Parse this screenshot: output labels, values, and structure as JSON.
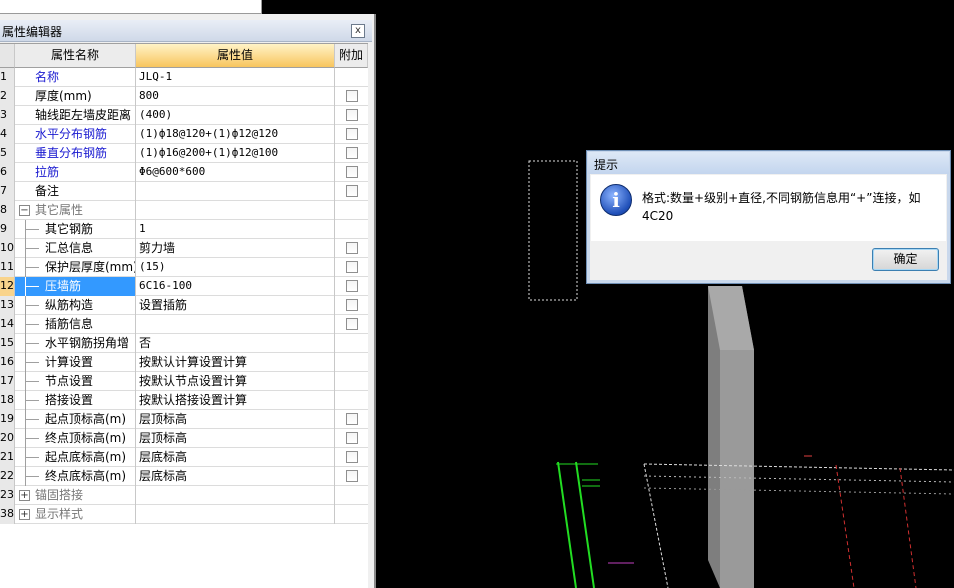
{
  "editor": {
    "title": "属性编辑器",
    "close_label": "x",
    "columns": {
      "name": "属性名称",
      "value": "属性值",
      "extra": "附加"
    },
    "rows": [
      {
        "num": "1",
        "name": "名称",
        "value": "JLQ-1",
        "style": "blue",
        "indent": 0,
        "checkbox": false
      },
      {
        "num": "2",
        "name": "厚度(mm)",
        "value": "800",
        "style": "normal",
        "indent": 0,
        "checkbox": true
      },
      {
        "num": "3",
        "name": "轴线距左墙皮距离",
        "value": "(400)",
        "style": "normal",
        "indent": 0,
        "checkbox": true
      },
      {
        "num": "4",
        "name": "水平分布钢筋",
        "value": "(1)ф18@120+(1)ф12@120",
        "style": "blue",
        "indent": 0,
        "checkbox": true
      },
      {
        "num": "5",
        "name": "垂直分布钢筋",
        "value": "(1)ф16@200+(1)ф12@100",
        "style": "blue",
        "indent": 0,
        "checkbox": true
      },
      {
        "num": "6",
        "name": "拉筋",
        "value": "Φ6@600*600",
        "style": "blue",
        "indent": 0,
        "checkbox": true
      },
      {
        "num": "7",
        "name": "备注",
        "value": "",
        "style": "normal",
        "indent": 0,
        "checkbox": true
      },
      {
        "num": "8",
        "name": "其它属性",
        "value": "",
        "style": "gray",
        "indent": 0,
        "expander": "−",
        "checkbox": false
      },
      {
        "num": "9",
        "name": "其它钢筋",
        "value": "1",
        "style": "normal",
        "indent": 1,
        "checkbox": false
      },
      {
        "num": "10",
        "name": "汇总信息",
        "value": "剪力墙",
        "style": "normal",
        "indent": 1,
        "checkbox": true
      },
      {
        "num": "11",
        "name": "保护层厚度(mm)",
        "value": "(15)",
        "style": "normal",
        "indent": 1,
        "checkbox": true
      },
      {
        "num": "12",
        "name": "压墙筋",
        "value": "6C16-100",
        "style": "normal",
        "indent": 1,
        "checkbox": true,
        "selected": true
      },
      {
        "num": "13",
        "name": "纵筋构造",
        "value": "设置插筋",
        "style": "normal",
        "indent": 1,
        "checkbox": true
      },
      {
        "num": "14",
        "name": "插筋信息",
        "value": "",
        "style": "normal",
        "indent": 1,
        "checkbox": true
      },
      {
        "num": "15",
        "name": "水平钢筋拐角增",
        "value": "否",
        "style": "normal",
        "indent": 1,
        "checkbox": false
      },
      {
        "num": "16",
        "name": "计算设置",
        "value": "按默认计算设置计算",
        "style": "normal",
        "indent": 1,
        "checkbox": false
      },
      {
        "num": "17",
        "name": "节点设置",
        "value": "按默认节点设置计算",
        "style": "normal",
        "indent": 1,
        "checkbox": false
      },
      {
        "num": "18",
        "name": "搭接设置",
        "value": "按默认搭接设置计算",
        "style": "normal",
        "indent": 1,
        "checkbox": false
      },
      {
        "num": "19",
        "name": "起点顶标高(m)",
        "value": "层顶标高",
        "style": "normal",
        "indent": 1,
        "checkbox": true
      },
      {
        "num": "20",
        "name": "终点顶标高(m)",
        "value": "层顶标高",
        "style": "normal",
        "indent": 1,
        "checkbox": true
      },
      {
        "num": "21",
        "name": "起点底标高(m)",
        "value": "层底标高",
        "style": "normal",
        "indent": 1,
        "checkbox": true
      },
      {
        "num": "22",
        "name": "终点底标高(m)",
        "value": "层底标高",
        "style": "normal",
        "indent": 1,
        "checkbox": true
      },
      {
        "num": "23",
        "name": "锚固搭接",
        "value": "",
        "style": "gray",
        "indent": 0,
        "expander": "+",
        "checkbox": false
      },
      {
        "num": "38",
        "name": "显示样式",
        "value": "",
        "style": "gray",
        "indent": 0,
        "expander": "+",
        "checkbox": false
      }
    ]
  },
  "dialog": {
    "title": "提示",
    "icon": "info-icon",
    "message": "格式:数量+级别+直径,不同钢筋信息用“+”连接，如4C20",
    "ok_label": "确定"
  },
  "colors": {
    "link_blue": "#1a1ad0",
    "selection": "#3399ff",
    "header_value": "#f8c55e",
    "cad_background": "#000000"
  }
}
